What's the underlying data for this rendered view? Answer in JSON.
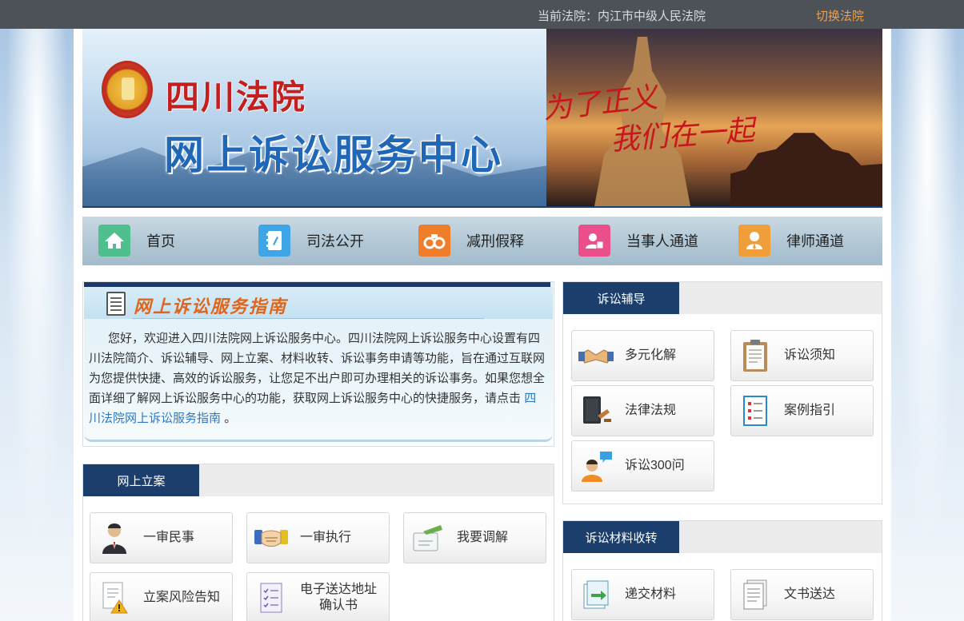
{
  "topbar": {
    "current_court": "当前法院：内江市中级人民法院",
    "switch_court": "切换法院"
  },
  "banner": {
    "title_line1": "四川法院",
    "title_line2": "网上诉讼服务中心",
    "slogan_line1": "为了正义",
    "slogan_line2": "我们在一起"
  },
  "nav": {
    "items": [
      {
        "label": "首页",
        "icon": "home-icon",
        "color": "#4fc08d"
      },
      {
        "label": "司法公开",
        "icon": "book-icon",
        "color": "#3ea5e6"
      },
      {
        "label": "减刑假释",
        "icon": "handcuffs-icon",
        "color": "#f07d2a"
      },
      {
        "label": "当事人通道",
        "icon": "person-id-icon",
        "color": "#ea4f8c"
      },
      {
        "label": "律师通道",
        "icon": "lawyer-icon",
        "color": "#f09e3a"
      }
    ]
  },
  "guide": {
    "title": "网上诉讼服务指南",
    "text": "您好，欢迎进入四川法院网上诉讼服务中心。四川法院网上诉讼服务中心设置有四川法院简介、诉讼辅导、网上立案、材料收转、诉讼事务申请等功能，旨在通过互联网为您提供快捷、高效的诉讼服务，让您足不出户即可办理相关的诉讼事务。如果您想全面详细了解网上诉讼服务中心的功能，获取网上诉讼服务中心的快捷服务，请点击",
    "link": "四川法院网上诉讼服务指南",
    "suffix": "。"
  },
  "online_filing": {
    "tab": "网上立案",
    "cards": [
      {
        "label": "一审民事",
        "icon": "person-suit-icon"
      },
      {
        "label": "一审执行",
        "icon": "handshake-icon"
      },
      {
        "label": "我要调解",
        "icon": "mediation-icon"
      },
      {
        "label": "立案风险告知",
        "icon": "warning-doc-icon"
      },
      {
        "label": "电子送达地址确认书",
        "label_line1": "电子送达地址",
        "label_line2": "确认书",
        "icon": "checklist-icon"
      }
    ]
  },
  "litigation_guidance": {
    "tab": "诉讼辅导",
    "cards": [
      {
        "label": "多元化解",
        "icon": "handshake-icon"
      },
      {
        "label": "诉讼须知",
        "icon": "clipboard-icon"
      },
      {
        "label": "法律法规",
        "icon": "law-book-icon"
      },
      {
        "label": "案例指引",
        "icon": "case-list-icon"
      },
      {
        "label": "诉讼300问",
        "icon": "chat-person-icon"
      }
    ]
  },
  "materials": {
    "tab": "诉讼材料收转",
    "cards": [
      {
        "label": "递交材料",
        "icon": "submit-doc-icon"
      },
      {
        "label": "文书送达",
        "icon": "documents-icon"
      }
    ]
  }
}
